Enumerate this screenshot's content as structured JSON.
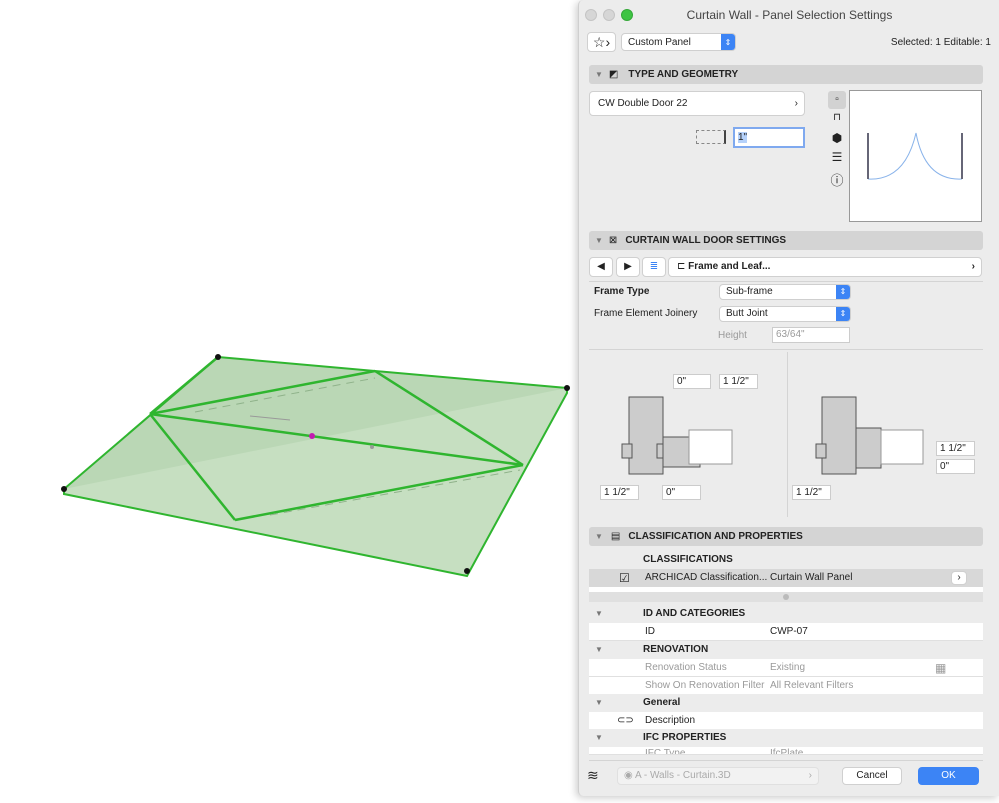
{
  "dialog": {
    "title": "Curtain Wall - Panel Selection Settings",
    "favorite_label": "Custom Panel",
    "selection_status": "Selected: 1 Editable: 1"
  },
  "type_geometry": {
    "header": "TYPE AND GEOMETRY",
    "panel_type": "CW Double Door 22",
    "thickness": "1\""
  },
  "door_settings": {
    "header": "CURTAIN WALL DOOR SETTINGS",
    "page": "Frame and Leaf...",
    "frame_type_label": "Frame Type",
    "frame_type_value": "Sub-frame",
    "joinery_label": "Frame Element Joinery",
    "joinery_value": "Butt Joint",
    "height_label": "Height",
    "height_value": "63/64\"",
    "left_dims": {
      "top_a": "0\"",
      "top_b": "1 1/2\"",
      "bottom_a": "1 1/2\"",
      "bottom_b": "0\""
    },
    "right_dims": {
      "side_a": "1 1/2\"",
      "side_b": "0\"",
      "bottom": "1 1/2\""
    }
  },
  "classification": {
    "header": "CLASSIFICATION AND PROPERTIES",
    "classifications_label": "CLASSIFICATIONS",
    "row_name": "ARCHICAD Classification...",
    "row_value": "Curtain Wall Panel",
    "id_group": "ID AND CATEGORIES",
    "id_label": "ID",
    "id_value": "CWP-07",
    "renovation_group": "RENOVATION",
    "renovation_status_label": "Renovation Status",
    "renovation_status_value": "Existing",
    "renovation_filter_label": "Show On Renovation Filter",
    "renovation_filter_value": "All Relevant Filters",
    "general_group": "General",
    "description_label": "Description",
    "ifc_group": "IFC PROPERTIES",
    "ifc_type_label": "IFC Type",
    "ifc_type_value": "IfcPlate"
  },
  "footer": {
    "layer": "A - Walls - Curtain.3D",
    "cancel": "Cancel",
    "ok": "OK"
  },
  "colors": {
    "accent": "#3c84f5",
    "selection_green": "#2fb52f",
    "fill_green": "#a9cfa3"
  }
}
